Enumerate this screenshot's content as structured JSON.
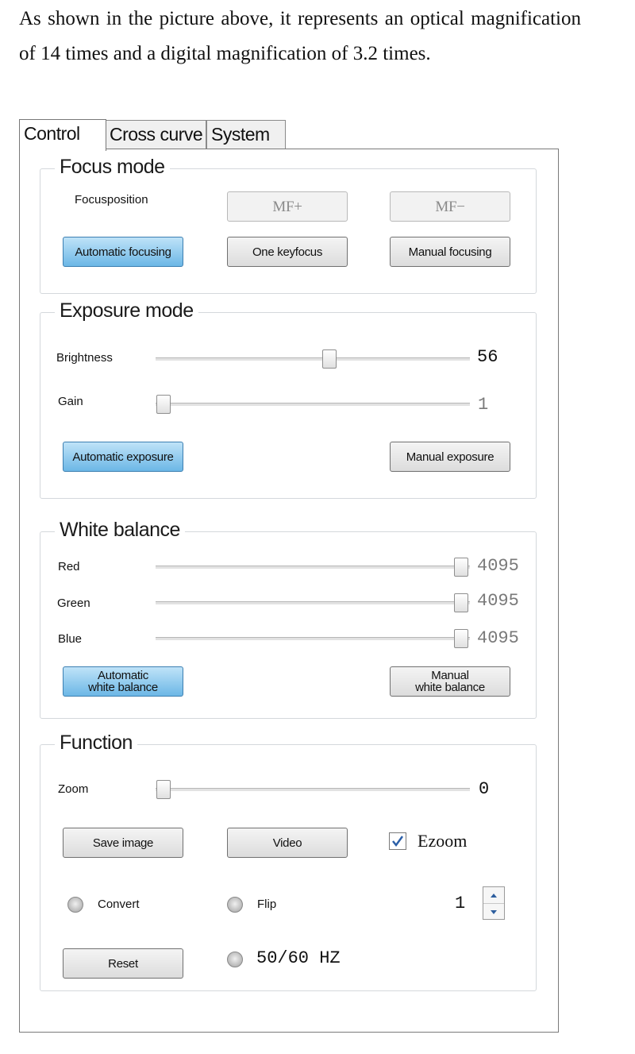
{
  "intro_text": "As shown in the picture above, it represents an optical magnification of 14 times and a digital magnification of 3.2 times.",
  "tabs": [
    {
      "label": "Control",
      "active": true
    },
    {
      "label": "Cross curve",
      "active": false
    },
    {
      "label": "System",
      "active": false
    }
  ],
  "focus": {
    "title": "Focus mode",
    "position_label": "Focusposition",
    "mf_plus": "MF+",
    "mf_minus": "MF−",
    "auto_btn": "Automatic focusing",
    "one_key_btn": "One keyfocus",
    "manual_btn": "Manual focusing"
  },
  "exposure": {
    "title": "Exposure mode",
    "brightness_label": "Brightness",
    "brightness_value": "56",
    "gain_label": "Gain",
    "gain_value": "1",
    "auto_btn": "Automatic exposure",
    "manual_btn": "Manual exposure"
  },
  "white_balance": {
    "title": "White balance",
    "red_label": "Red",
    "red_value": "4095",
    "green_label": "Green",
    "green_value": "4095",
    "blue_label": "Blue",
    "blue_value": "4095",
    "auto_btn_line1": "Automatic",
    "auto_btn_line2": "white balance",
    "manual_btn_line1": "Manual",
    "manual_btn_line2": "white balance"
  },
  "function": {
    "title": "Function",
    "zoom_label": "Zoom",
    "zoom_value": "0",
    "save_image_btn": "Save image",
    "video_btn": "Video",
    "ezoom_label": "Ezoom",
    "ezoom_checked": true,
    "convert_label": "Convert",
    "flip_label": "Flip",
    "spin_value": "1",
    "reset_btn": "Reset",
    "hz_label": "50/60 HZ"
  },
  "colors": {
    "accent_button": "#6cb7e6",
    "panel_border": "#7a7a7a"
  }
}
